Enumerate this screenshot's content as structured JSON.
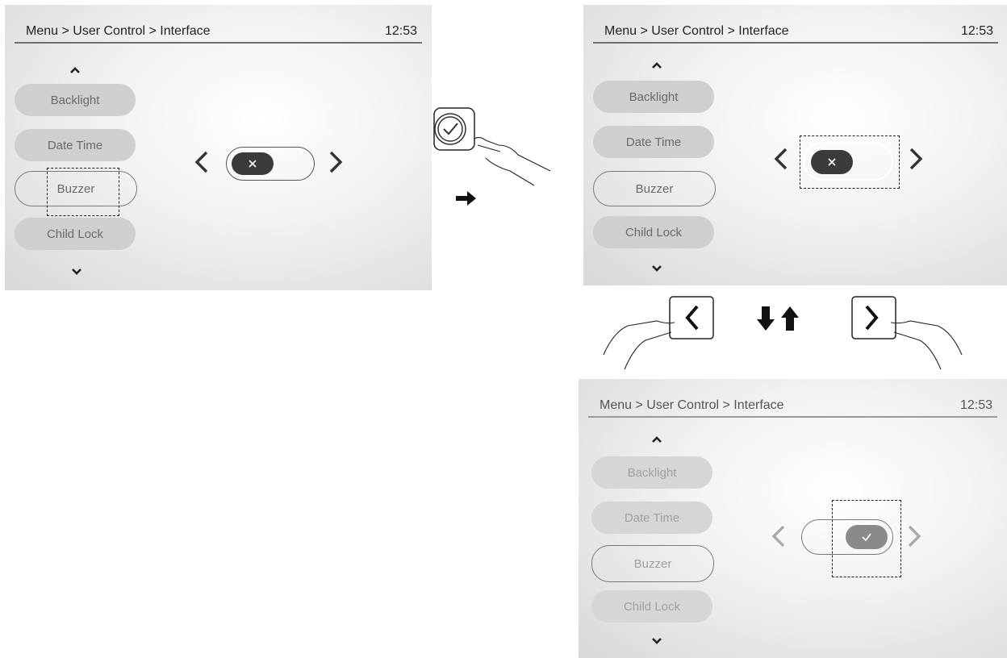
{
  "screens": [
    {
      "header": {
        "breadcrumb": "Menu > User Control > Interface",
        "time": "12:53"
      },
      "menu_items": [
        "Backlight",
        "Date Time",
        "Buzzer",
        "Child Lock"
      ],
      "selected_item": "Buzzer",
      "toggle_state": "off"
    },
    {
      "header": {
        "breadcrumb": "Menu > User Control > Interface",
        "time": "12:53"
      },
      "menu_items": [
        "Backlight",
        "Date Time",
        "Buzzer",
        "Child Lock"
      ],
      "selected_item": "Buzzer",
      "toggle_state": "off"
    },
    {
      "header": {
        "breadcrumb": "Menu > User Control > Interface",
        "time": "12:53"
      },
      "menu_items": [
        "Backlight",
        "Date Time",
        "Buzzer",
        "Child Lock"
      ],
      "selected_item": "Buzzer",
      "toggle_state": "on"
    }
  ],
  "icons": {
    "confirm_button": "check-circle-icon",
    "left_button": "chevron-left-icon",
    "right_button": "chevron-right-icon",
    "flow_arrow": "arrow-right-icon",
    "cycle_arrows": "arrows-down-up-icon",
    "finger": "pointing-hand-icon"
  },
  "colors": {
    "knob_off": "#3b3b3b",
    "knob_on": "#8a8a8a"
  }
}
